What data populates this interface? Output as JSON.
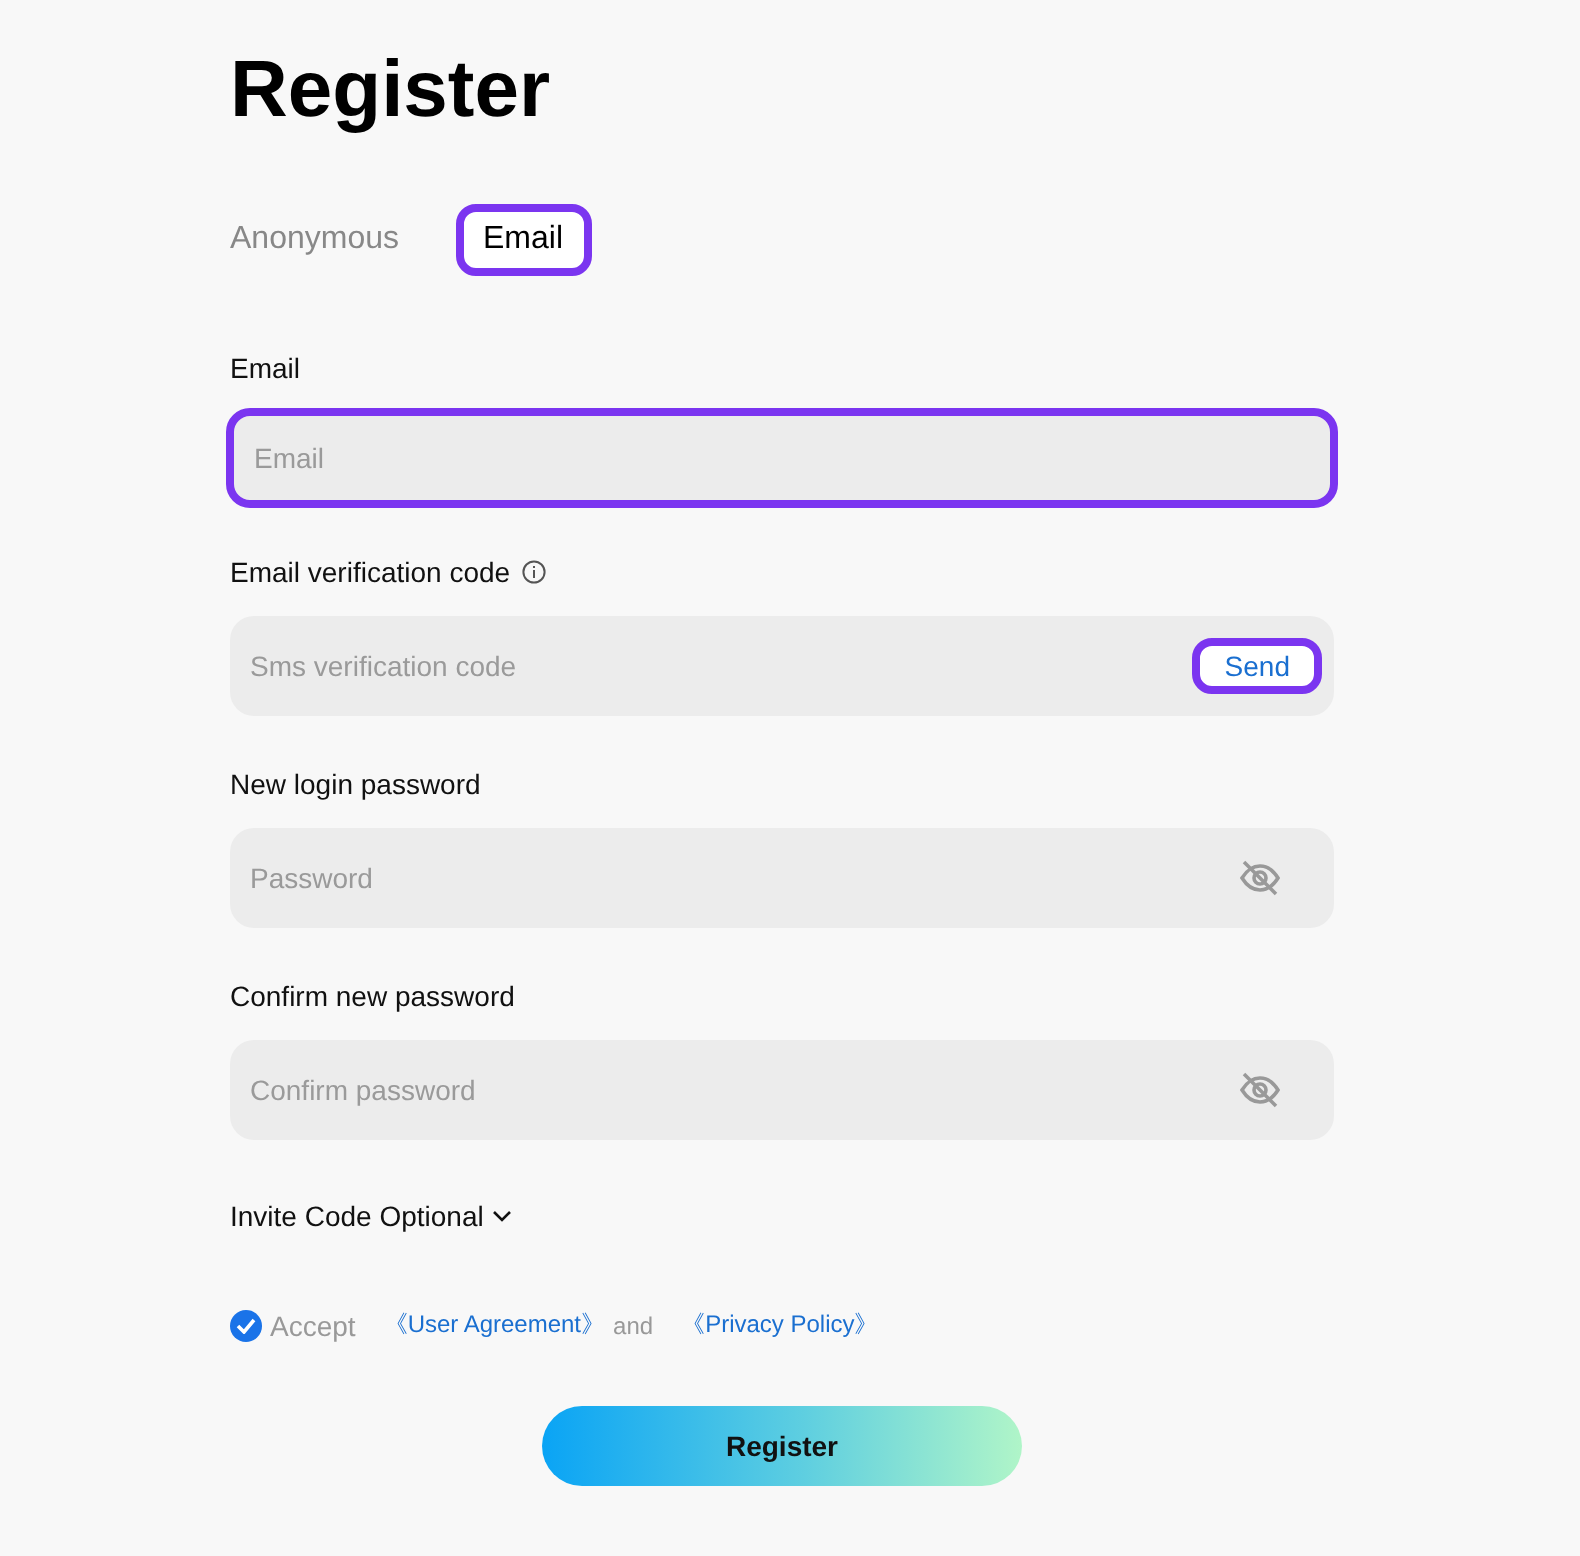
{
  "title": "Register",
  "tabs": [
    {
      "label": "Anonymous",
      "selected": false
    },
    {
      "label": "Email",
      "selected": true
    }
  ],
  "fields": [
    {
      "kind": "text",
      "label": "Email",
      "placeholder": "Email",
      "highlighted": true
    },
    {
      "kind": "code",
      "label": "Email verification code",
      "info": true,
      "placeholder": "Sms verification code",
      "action": "Send",
      "highlighted": false
    },
    {
      "kind": "password",
      "label": "New login password",
      "placeholder": "Password",
      "highlighted": false
    },
    {
      "kind": "password",
      "label": "Confirm new password",
      "placeholder": "Confirm password",
      "highlighted": false
    }
  ],
  "send_highlighted": true,
  "invite": {
    "label": "Invite Code Optional",
    "expanded": false
  },
  "agreement": {
    "checked": true,
    "accept": "Accept",
    "user_agreement": "《User Agreement》",
    "and": "and",
    "privacy_policy": "《Privacy Policy》"
  },
  "submit": "Register"
}
